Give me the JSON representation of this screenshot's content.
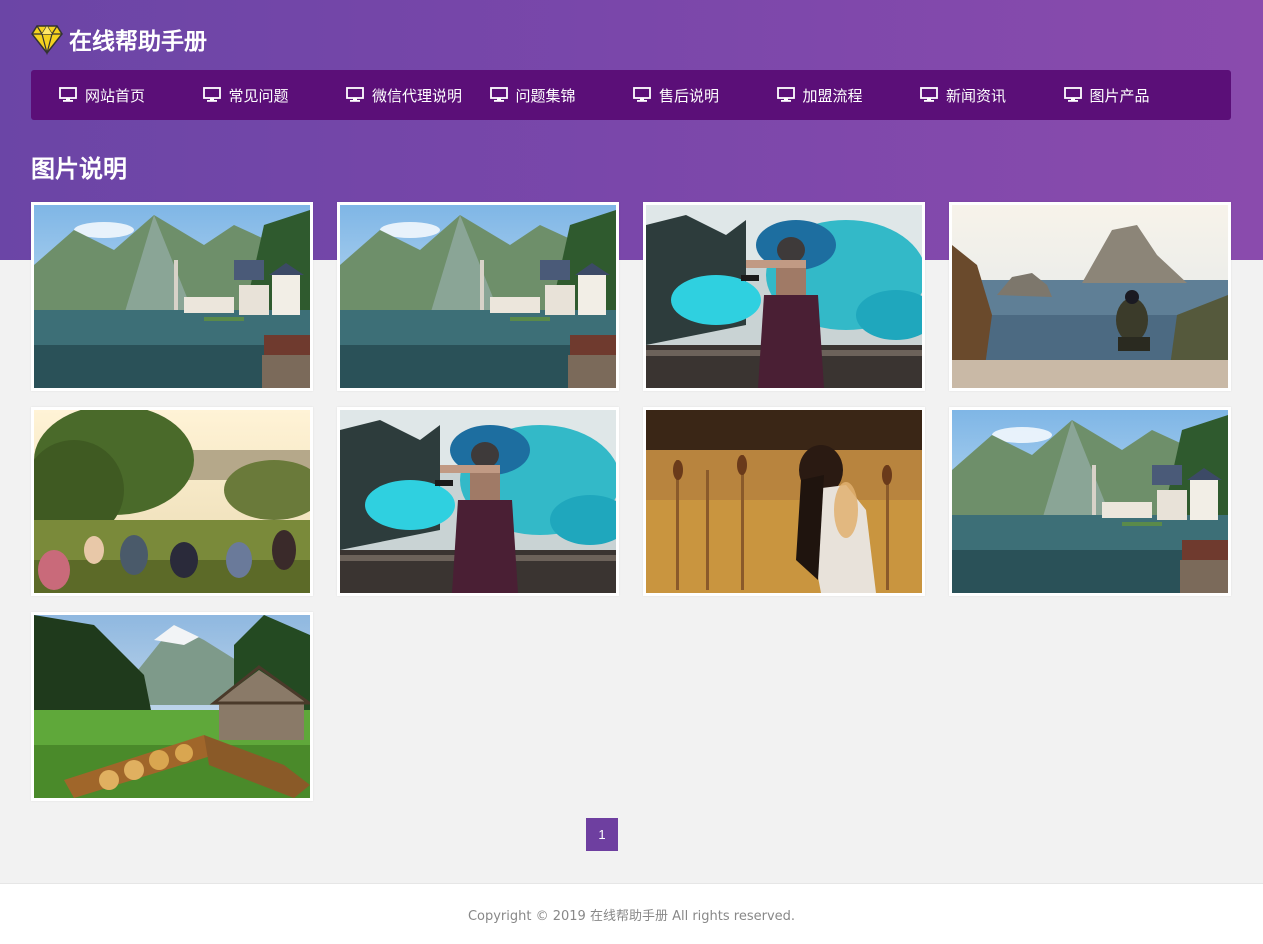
{
  "header": {
    "logo_icon": "diamond-icon",
    "site_title": "在线帮助手册"
  },
  "nav": {
    "items": [
      {
        "label": "网站首页",
        "icon": "monitor-icon"
      },
      {
        "label": "常见问题",
        "icon": "monitor-icon"
      },
      {
        "label": "微信代理说明",
        "icon": "monitor-icon"
      },
      {
        "label": "问题集锦",
        "icon": "monitor-icon"
      },
      {
        "label": "售后说明",
        "icon": "monitor-icon"
      },
      {
        "label": "加盟流程",
        "icon": "monitor-icon"
      },
      {
        "label": "新闻资讯",
        "icon": "monitor-icon"
      },
      {
        "label": "图片产品",
        "icon": "monitor-icon"
      }
    ]
  },
  "main": {
    "section_title": "图片说明",
    "photos": [
      {
        "subject": "lake-village"
      },
      {
        "subject": "lake-village"
      },
      {
        "subject": "smoke-girl"
      },
      {
        "subject": "sea-rock"
      },
      {
        "subject": "park-crowd"
      },
      {
        "subject": "smoke-girl"
      },
      {
        "subject": "field-woman"
      },
      {
        "subject": "lake-village"
      },
      {
        "subject": "forest-cabin"
      }
    ]
  },
  "pagination": {
    "current": "1"
  },
  "footer": {
    "copyright": "Copyright © 2019 在线帮助手册 All rights reserved."
  },
  "colors": {
    "header_gradient_start": "#6b45a6",
    "header_gradient_end": "#8a4bad",
    "nav_bg": "#5b0f78",
    "pager_bg": "#6e3fa0",
    "page_bg": "#f2f2f2"
  }
}
